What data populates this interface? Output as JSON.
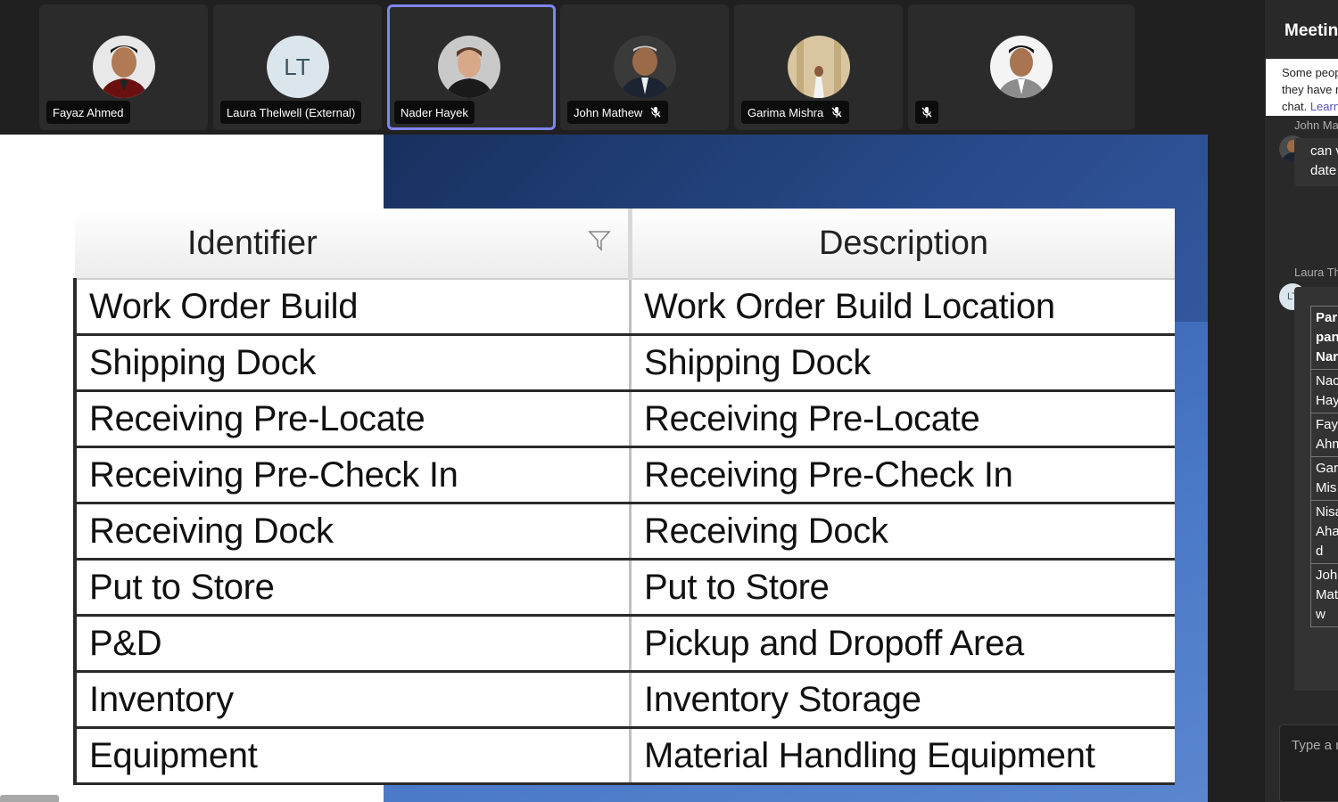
{
  "participants": [
    {
      "name": "Fayaz Ahmed",
      "muted": false,
      "active": false,
      "avatar": "photo-fayaz"
    },
    {
      "name": "Laura Thelwell (External)",
      "muted": false,
      "active": false,
      "initials": "LT"
    },
    {
      "name": "Nader Hayek",
      "muted": false,
      "active": true,
      "avatar": "photo-nader"
    },
    {
      "name": "John Mathew",
      "muted": true,
      "active": false,
      "avatar": "photo-john"
    },
    {
      "name": "Garima Mishra",
      "muted": true,
      "active": false,
      "avatar": "photo-garima"
    },
    {
      "name": "",
      "muted": true,
      "active": false,
      "avatar": "photo-unnamed"
    }
  ],
  "shared_table": {
    "headers": {
      "identifier": "Identifier",
      "description": "Description"
    },
    "rows": [
      {
        "identifier": "Work Order Build",
        "description": "Work Order Build Location"
      },
      {
        "identifier": "Shipping Dock",
        "description": "Shipping Dock"
      },
      {
        "identifier": "Receiving Pre-Locate",
        "description": "Receiving Pre-Locate"
      },
      {
        "identifier": "Receiving Pre-Check In",
        "description": "Receiving Pre-Check In"
      },
      {
        "identifier": "Receiving Dock",
        "description": "Receiving Dock"
      },
      {
        "identifier": "Put to Store",
        "description": "Put to Store"
      },
      {
        "identifier": "P&D",
        "description": "Pickup and Dropoff Area"
      },
      {
        "identifier": "Inventory",
        "description": "Inventory Storage"
      },
      {
        "identifier": "Equipment",
        "description": "Material Handling Equipment"
      }
    ]
  },
  "chat_panel": {
    "title": "Meetin",
    "notice_lines": [
      "Some peop",
      "they have r",
      "chat."
    ],
    "notice_link": "Learn",
    "messages": [
      {
        "sender": "John Ma",
        "lines": [
          "can v",
          "date"
        ]
      },
      {
        "sender": "Laura Th",
        "initials": "LT"
      }
    ],
    "participant_table": [
      {
        "text": "Par\npan\nNar",
        "bold": true
      },
      {
        "text": "Nac\nHay",
        "bold": false
      },
      {
        "text": "Faya\nAhm",
        "bold": false
      },
      {
        "text": "Gari\nMis",
        "bold": false
      },
      {
        "text": "Nisa\nAha\nd",
        "bold": false
      },
      {
        "text": "John\nMat\nw",
        "bold": false
      }
    ],
    "compose_placeholder": "Type a r"
  },
  "colors": {
    "accent": "#7f85f5",
    "presence_busy": "#d13438",
    "link": "#4f52b2"
  }
}
